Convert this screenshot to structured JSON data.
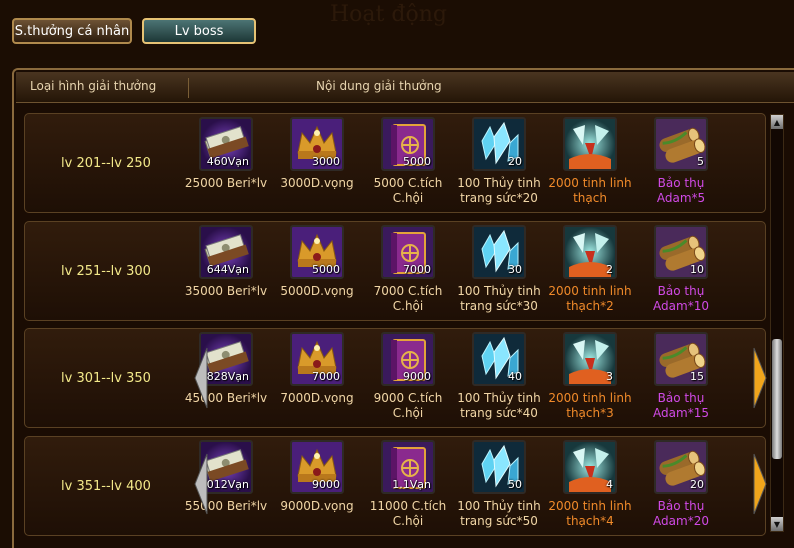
{
  "background_title": "Hoạt động",
  "tabs": [
    {
      "label": "S.thưởng cá nhân",
      "active": false
    },
    {
      "label": "Lv boss",
      "active": true
    }
  ],
  "table": {
    "headers": [
      "Loại hình giải thưởng",
      "Nội dung giải thưởng"
    ],
    "rows": [
      {
        "level": "lv 201--lv 250",
        "items": [
          {
            "icon": "money-icon",
            "count": "460Vạn",
            "cap1": "25000 Beri*lv",
            "cap2": "",
            "color": "white"
          },
          {
            "icon": "crown-icon",
            "count": "3000",
            "cap1": "3000D.vọng",
            "cap2": "",
            "color": "white"
          },
          {
            "icon": "book-icon",
            "count": "5000",
            "cap1": "5000 C.tích",
            "cap2": "C.hội",
            "color": "white"
          },
          {
            "icon": "crystal-icon",
            "count": "20",
            "cap1": "100 Thủy tinh",
            "cap2": "trang sức*20",
            "color": "white"
          },
          {
            "icon": "spirit-stone-icon",
            "count": "",
            "cap1": "2000 tinh linh",
            "cap2": "thạch",
            "color": "orange"
          },
          {
            "icon": "wood-icon",
            "count": "5",
            "cap1": "Bảo thụ",
            "cap2": "Adam*5",
            "color": "purple"
          }
        ]
      },
      {
        "level": "lv 251--lv 300",
        "items": [
          {
            "icon": "money-icon",
            "count": "644Vạn",
            "cap1": "35000 Beri*lv",
            "cap2": "",
            "color": "white"
          },
          {
            "icon": "crown-icon",
            "count": "5000",
            "cap1": "5000D.vọng",
            "cap2": "",
            "color": "white"
          },
          {
            "icon": "book-icon",
            "count": "7000",
            "cap1": "7000 C.tích",
            "cap2": "C.hội",
            "color": "white"
          },
          {
            "icon": "crystal-icon",
            "count": "30",
            "cap1": "100 Thủy tinh",
            "cap2": "trang sức*30",
            "color": "white"
          },
          {
            "icon": "spirit-stone-icon",
            "count": "2",
            "cap1": "2000 tinh linh",
            "cap2": "thạch*2",
            "color": "orange"
          },
          {
            "icon": "wood-icon",
            "count": "10",
            "cap1": "Bảo thụ",
            "cap2": "Adam*10",
            "color": "purple"
          }
        ]
      },
      {
        "level": "lv 301--lv 350",
        "items": [
          {
            "icon": "money-icon",
            "count": "828Vạn",
            "cap1": "45000 Beri*lv",
            "cap2": "",
            "color": "white"
          },
          {
            "icon": "crown-icon",
            "count": "7000",
            "cap1": "7000D.vọng",
            "cap2": "",
            "color": "white"
          },
          {
            "icon": "book-icon",
            "count": "9000",
            "cap1": "9000 C.tích",
            "cap2": "C.hội",
            "color": "white"
          },
          {
            "icon": "crystal-icon",
            "count": "40",
            "cap1": "100 Thủy tinh",
            "cap2": "trang sức*40",
            "color": "white"
          },
          {
            "icon": "spirit-stone-icon",
            "count": "3",
            "cap1": "2000 tinh linh",
            "cap2": "thạch*3",
            "color": "orange"
          },
          {
            "icon": "wood-icon",
            "count": "15",
            "cap1": "Bảo thụ",
            "cap2": "Adam*15",
            "color": "purple"
          }
        ]
      },
      {
        "level": "lv 351--lv 400",
        "items": [
          {
            "icon": "money-icon",
            "count": "1012Vạn",
            "cap1": "55000 Beri*lv",
            "cap2": "",
            "color": "white"
          },
          {
            "icon": "crown-icon",
            "count": "9000",
            "cap1": "9000D.vọng",
            "cap2": "",
            "color": "white"
          },
          {
            "icon": "book-icon",
            "count": "1.1Vạn",
            "cap1": "11000 C.tích",
            "cap2": "C.hội",
            "color": "white"
          },
          {
            "icon": "crystal-icon",
            "count": "50",
            "cap1": "100 Thủy tinh",
            "cap2": "trang sức*50",
            "color": "white"
          },
          {
            "icon": "spirit-stone-icon",
            "count": "4",
            "cap1": "2000 tinh linh",
            "cap2": "thạch*4",
            "color": "orange"
          },
          {
            "icon": "wood-icon",
            "count": "20",
            "cap1": "Bảo thụ",
            "cap2": "Adam*20",
            "color": "purple"
          }
        ]
      }
    ]
  },
  "colors": {
    "level_text": "#f3e98a",
    "accent_gold": "#e6c274",
    "orange_text": "#f08a2a",
    "purple_text": "#d04ae6"
  }
}
